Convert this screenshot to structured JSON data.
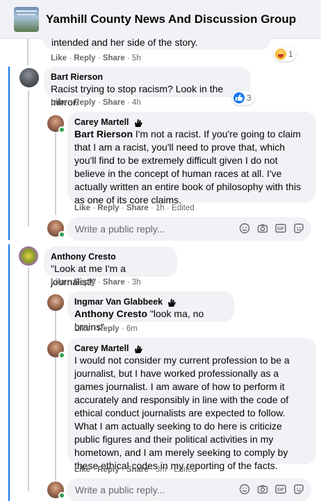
{
  "header": {
    "group_name": "Yamhill County News And Discussion Group"
  },
  "top_comment": {
    "text_tail": "intended and her side of the story.",
    "actions": {
      "like": "Like",
      "reply": "Reply",
      "share": "Share",
      "time": "5h"
    },
    "reaction_count": "1"
  },
  "comment_bart": {
    "author": "Bart Rierson",
    "text": "Racist trying to stop racism? Look in the mirror.",
    "actions": {
      "like": "Like",
      "reply": "Reply",
      "share": "Share",
      "time": "4h"
    },
    "reaction_count": "3"
  },
  "reply_carey_1": {
    "author": "Carey Martell",
    "mention": "Bart Rierson",
    "text": " I'm not a racist. If you're going to claim that I am a racist, you'll need to prove that, which you'll find to be extremely difficult given I do not believe in the concept of human races at all. I've actually written an entire book of philosophy with this as one of its core claims.",
    "actions": {
      "like": "Like",
      "reply": "Reply",
      "share": "Share",
      "time": "1h",
      "edited": "Edited"
    }
  },
  "reply_box_1": {
    "placeholder": "Write a public reply..."
  },
  "comment_anthony": {
    "author": "Anthony Cresto",
    "text": "\"Look at me I'm a journalist!\"",
    "actions": {
      "like": "Like",
      "reply": "Reply",
      "share": "Share",
      "time": "3h"
    }
  },
  "reply_ingmar": {
    "author": "Ingmar Van Glabbeek",
    "mention": "Anthony Cresto",
    "text": " \"look ma, no brains\"",
    "actions": {
      "like": "Like",
      "reply": "Reply",
      "time": "6m"
    }
  },
  "reply_carey_2": {
    "author": "Carey Martell",
    "text": "I would not consider my current profession to be a journalist, but I have worked professionally as a games journalist. I am aware of how to perform it accurately and responsibly in line with the code of ethical conduct journalists are expected to follow. What I am actually seeking to do here is criticize public figures and their political activities in my hometown, and I am merely seeking to comply by these ethical codes in my reporting of the facts.",
    "actions": {
      "like": "Like",
      "reply": "Reply",
      "share": "Share",
      "time": "3m",
      "edited": "Edited"
    }
  },
  "reply_box_2": {
    "placeholder": "Write a public reply..."
  },
  "colors": {
    "accent": "#1877f2",
    "bubble": "#f0f2f5",
    "online": "#31a24c",
    "meta": "#65676b"
  }
}
